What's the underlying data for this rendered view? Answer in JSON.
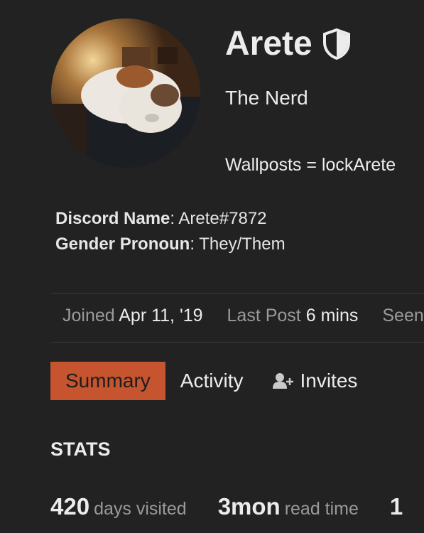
{
  "profile": {
    "username": "Arete",
    "title": "The Nerd",
    "bio": "Wallposts = lockArete"
  },
  "fields": [
    {
      "label": "Discord Name",
      "value": "Arete#7872"
    },
    {
      "label": "Gender Pronoun",
      "value": "They/Them"
    }
  ],
  "meta": {
    "joined_label": "Joined",
    "joined_value": "Apr 11, '19",
    "last_post_label": "Last Post",
    "last_post_value": "6 mins",
    "seen_label": "Seen"
  },
  "nav": {
    "summary": "Summary",
    "activity": "Activity",
    "invites": "Invites"
  },
  "stats": {
    "title": "STATS",
    "items": [
      {
        "value": "420",
        "label": "days visited"
      },
      {
        "value": "3mon",
        "label": "read time"
      },
      {
        "value": "1",
        "label": ""
      }
    ]
  },
  "colors": {
    "background": "#222222",
    "accent": "#c5542f",
    "muted_text": "#9a9a9a"
  },
  "icons": [
    "shield-icon",
    "add-user-icon"
  ]
}
